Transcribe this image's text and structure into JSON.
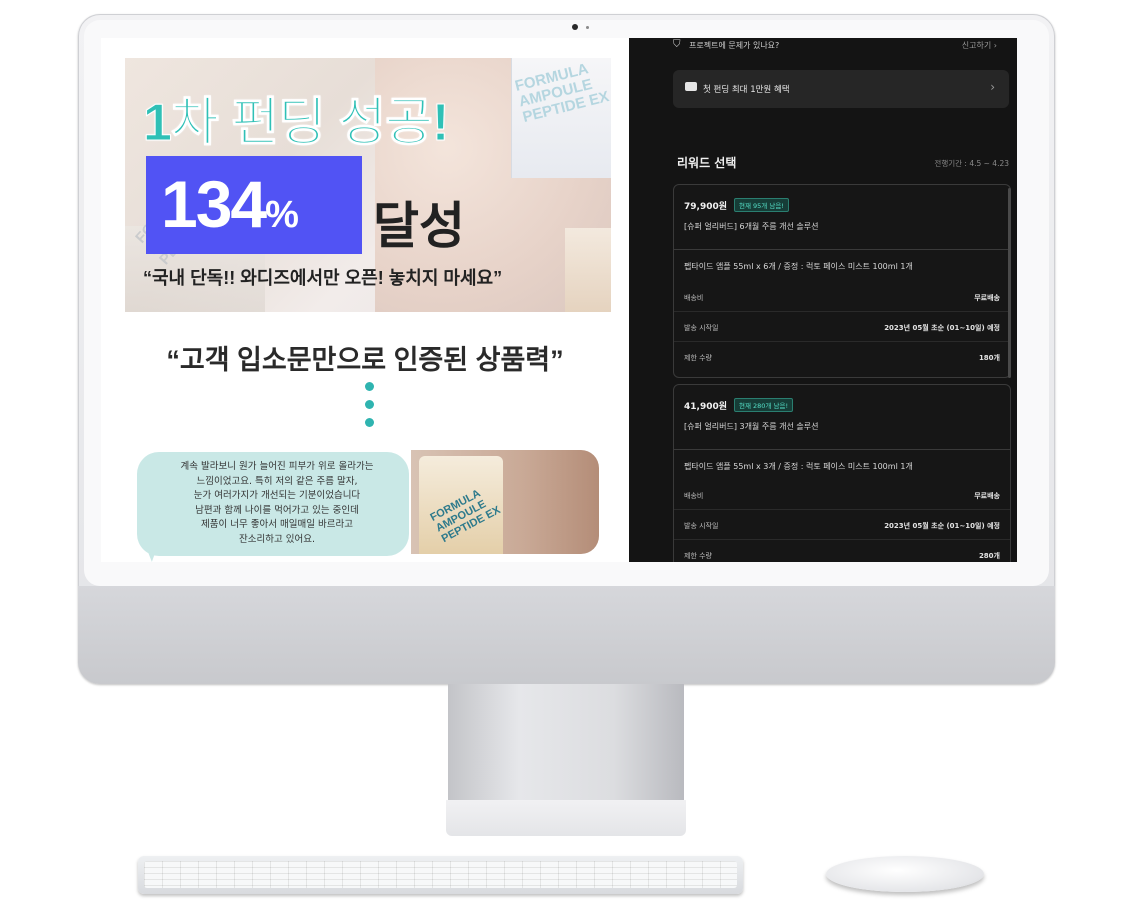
{
  "left_page": {
    "headline": "1차 펀딩 성공!",
    "achievement_percent": "134",
    "achievement_percent_sign": "%",
    "achievement_suffix": "달성",
    "hero_quote": "“국내 단독!! 와디즈에서만 오픈! 놓치지 마세요”",
    "sub_quote": "“고객 입소문만으로 인증된 상품력”",
    "product_label_lines": [
      "FORMULA",
      "AMPOULE",
      "PEPTIDE EX"
    ],
    "review_lines": [
      "계속 발라보니 원가 늘어진 피부가 위로 올라가는",
      "느낌이었고요. 특히 저의 같은 주름 말자,",
      "눈가 여러가지가 개선되는 기분이었습니다",
      "남편과 함께 나이를 먹어가고 있는 중인데",
      "제품이 너무 좋아서 매일매일 바르라고",
      "잔소리하고 있어요."
    ]
  },
  "right_panel": {
    "notice_text": "프로젝트에 문제가 있나요?",
    "notice_link": "신고하기",
    "benefit_text": "첫 펀딩 최대 1만원 혜택",
    "reward_title": "리워드 선택",
    "reward_period": "전행기간 : 4.5 ~ 4.23",
    "rewards": [
      {
        "price": "79,900원",
        "badge": "현재 95개 남음!",
        "name": "[슈퍼 얼리버드] 6개월 주름 개선 솔루션",
        "composition": "펩타이드 앰플 55ml x 6개 / 증정 : 럭토 페이스 미스트 100ml 1개",
        "rows": [
          {
            "label": "배송비",
            "value": "무료배송"
          },
          {
            "label": "발송 시작일",
            "value": "2023년 05월 초순 (01~10일) 예정"
          },
          {
            "label": "제한 수량",
            "value": "180개"
          }
        ]
      },
      {
        "price": "41,900원",
        "badge": "현재 280개 남음!",
        "name": "[슈퍼 얼리버드] 3개월 주름 개선 솔루션",
        "composition": "펩타이드 앰플 55ml x 3개 / 증정 : 럭토 페이스 미스트 100ml 1개",
        "rows": [
          {
            "label": "배송비",
            "value": "무료배송"
          },
          {
            "label": "발송 시작일",
            "value": "2023년 05월 초순 (01~10일) 예정"
          },
          {
            "label": "제한 수량",
            "value": "280개"
          }
        ]
      }
    ]
  },
  "colors": {
    "accent_teal": "#2fc0b6",
    "accent_purple": "#5153f4",
    "panel_bg": "#141414",
    "badge_green": "#55e0c8"
  }
}
